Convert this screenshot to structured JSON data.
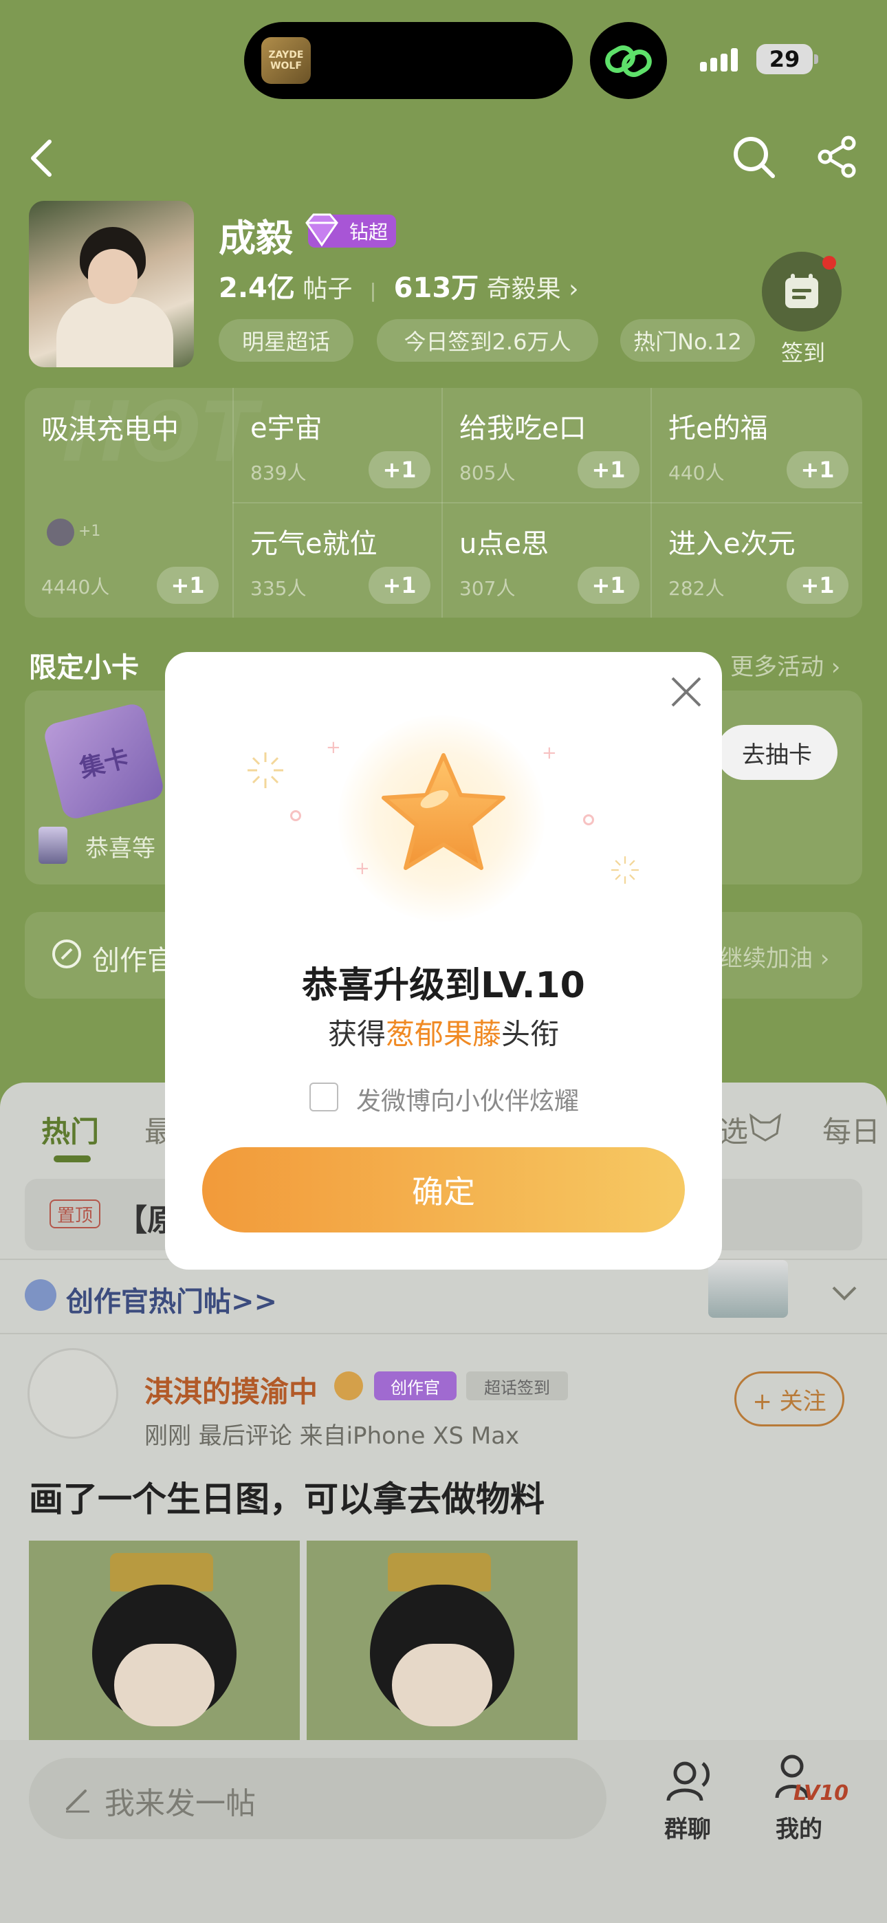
{
  "status_bar": {
    "island_app_label": "ZAYDE WOLF",
    "battery": "29"
  },
  "header": {
    "name": "成毅",
    "diamond_badge": "钻超",
    "posts_count": "2.4亿",
    "posts_label": "帖子",
    "fruits_count": "613万",
    "fruits_label": "奇毅果 ›",
    "tags": [
      "明星超话",
      "今日签到2.6万人",
      "热门No.12"
    ],
    "signin_label": "签到"
  },
  "groups": {
    "hero": {
      "title": "吸淇充电中",
      "count": "4440人",
      "plus": "+1",
      "watermark": "HOT"
    },
    "cells": [
      {
        "title": "e宇宙",
        "count": "839人",
        "plus": "+1"
      },
      {
        "title": "给我吃e口",
        "count": "805人",
        "plus": "+1"
      },
      {
        "title": "托e的福",
        "count": "440人",
        "plus": "+1"
      },
      {
        "title": "元气e就位",
        "count": "335人",
        "plus": "+1"
      },
      {
        "title": "u点e思",
        "count": "307人",
        "plus": "+1"
      },
      {
        "title": "进入e次元",
        "count": "282人",
        "plus": "+1"
      }
    ]
  },
  "limited_card": {
    "title": "限定小卡",
    "more": "更多活动 ›",
    "card_glyph": "集卡",
    "draw_button": "去抽卡",
    "line": "恭喜等"
  },
  "creator": {
    "text": "创作官",
    "right": "继续加油 ›"
  },
  "feed": {
    "tabs": [
      "热门",
      "最",
      "选",
      "每日"
    ],
    "pin_tag": "置顶",
    "pin_text": "【原",
    "hot_posts_link": "创作官热门帖>>",
    "post": {
      "author": "淇淇的摸渝中",
      "badge_creator": "创作官",
      "badge_signin": "超话签到",
      "meta": "刚刚  最后评论  来自iPhone XS Max",
      "follow": "+ 关注",
      "title": "画了一个生日图，可以拿去做物料"
    }
  },
  "bottom_bar": {
    "compose_placeholder": "我来发一帖",
    "group_chat": "群聊",
    "mine": "我的",
    "level_badge": "LV10"
  },
  "modal": {
    "title": "恭喜升级到LV.10",
    "subtitle_prefix": "获得",
    "subtitle_highlight": "葱郁果藤",
    "subtitle_suffix": "头衔",
    "checkbox_label": "发微博向小伙伴炫耀",
    "confirm": "确定",
    "accent_color": "#f08a24"
  }
}
